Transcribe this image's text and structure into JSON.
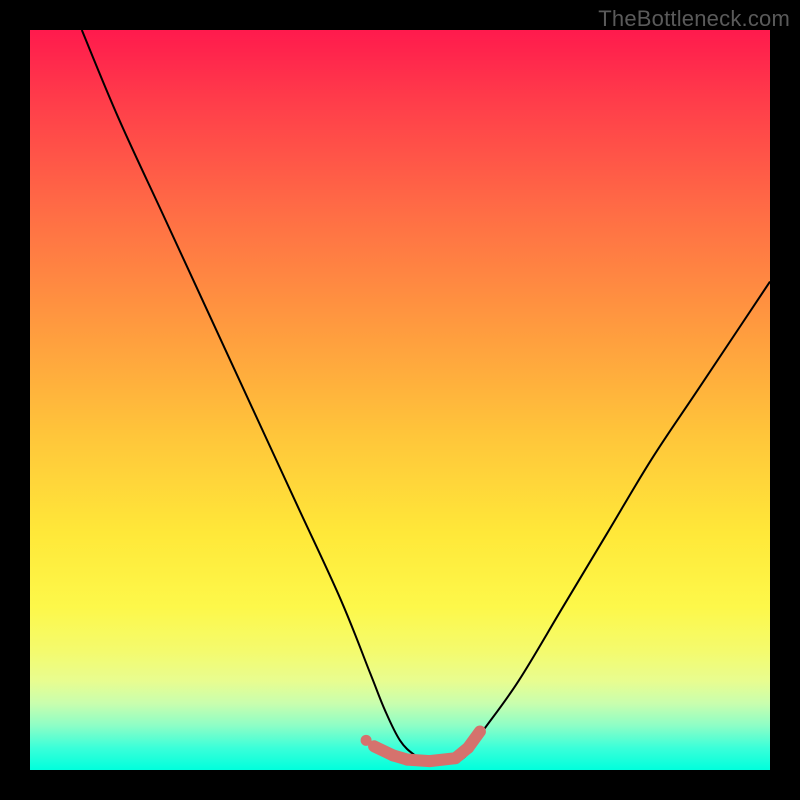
{
  "watermark": {
    "text": "TheBottleneck.com"
  },
  "chart_data": {
    "type": "line",
    "title": "",
    "xlabel": "",
    "ylabel": "",
    "xlim": [
      0,
      100
    ],
    "ylim": [
      0,
      100
    ],
    "grid": false,
    "legend": false,
    "series": [
      {
        "name": "curve",
        "stroke": "#000000",
        "stroke_width": 2,
        "x": [
          7,
          12,
          18,
          24,
          30,
          36,
          42,
          46,
          48,
          50,
          52,
          54,
          57,
          59,
          61,
          66,
          72,
          78,
          84,
          90,
          96,
          100
        ],
        "y": [
          100,
          88,
          75,
          62,
          49,
          36,
          23,
          13,
          8,
          4,
          2,
          1,
          1,
          2,
          5,
          12,
          22,
          32,
          42,
          51,
          60,
          66
        ]
      },
      {
        "name": "marker-band",
        "stroke": "#d5726d",
        "stroke_width": 12,
        "cap": "round",
        "x": [
          46.5,
          49,
          51,
          54,
          57.5,
          59.2,
          60.8
        ],
        "y": [
          3.2,
          2.0,
          1.4,
          1.2,
          1.6,
          3.0,
          5.2
        ]
      }
    ],
    "annotations": []
  }
}
